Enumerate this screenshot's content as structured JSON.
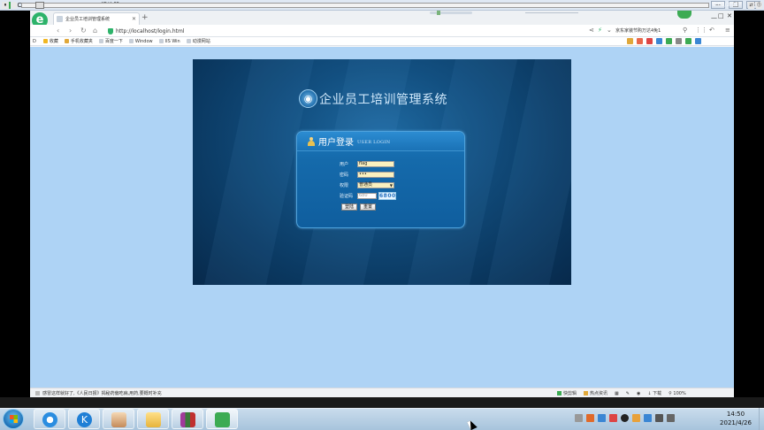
{
  "player": {
    "title": "SCREEN2EXE/SCREEN2SWF 播放器",
    "window_buttons": [
      "—",
      "□",
      "✕"
    ],
    "time": "0:03/3:11",
    "buttons": [
      "⏸",
      "↻",
      "⇄",
      "⓵"
    ]
  },
  "browser": {
    "logo_letter": "e",
    "tab_label": "企业员工培训管理系统",
    "new_tab": "+",
    "url": "http://localhost/login.html",
    "search_text": "京东家装节购万达4免1",
    "window_buttons": [
      "—",
      "□",
      "✕"
    ],
    "nav": {
      "back": "‹",
      "forward": "›",
      "reload": "↻",
      "home": "⌂"
    },
    "favorites": [
      {
        "label": "收藏",
        "icon": "star-icon"
      },
      {
        "label": "手机收藏夹",
        "icon": "folder-icon"
      },
      {
        "label": "百度一下",
        "icon": "doc-icon"
      },
      {
        "label": "Window",
        "icon": "doc-icon"
      },
      {
        "label": "IIS Win",
        "icon": "doc-icon"
      },
      {
        "label": "动漫网站",
        "icon": "doc-icon"
      }
    ],
    "favbar_prefix": "D",
    "status": {
      "left": "感冒这样就好了,《人民日报》揭秘药偏吃病,用药,要概时补充",
      "right": [
        "快剪辑",
        "热点资讯",
        "",
        "下载",
        "",
        "100%"
      ]
    }
  },
  "login": {
    "system_title": "企业员工培训管理系统",
    "box_title": "用户登录",
    "box_subtitle": "USER LOGIN",
    "fields": {
      "username_label": "用户",
      "username_value": "flag",
      "password_label": "密码",
      "password_value": "•••",
      "role_label": "权限",
      "role_value": "普通员",
      "captcha_label": "验证码",
      "captcha_value": "680",
      "captcha_code": "6800"
    },
    "buttons": {
      "login": "登陆",
      "reset": "重置"
    }
  },
  "taskbar": {
    "clock_time": "14:50",
    "clock_date": "2021/4/26",
    "apps": [
      "sogou-app",
      "kugou-app",
      "qq-app",
      "file-explorer-app",
      "winrar-app",
      "screen-recorder-app"
    ]
  }
}
